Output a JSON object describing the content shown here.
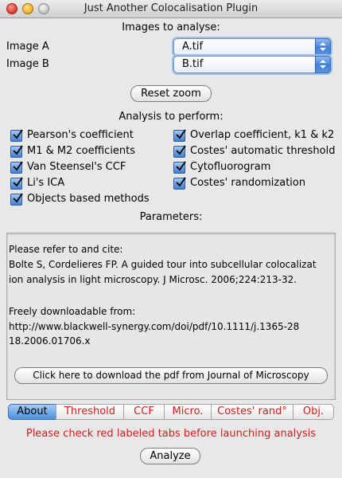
{
  "window": {
    "title": "Just Another Colocalisation Plugin"
  },
  "images": {
    "heading": "Images to analyse:",
    "image_a_label": "Image A",
    "image_a_value": "A.tif",
    "image_b_label": "Image B",
    "image_b_value": "B.tif"
  },
  "reset_zoom_label": "Reset zoom",
  "analysis": {
    "heading": "Analysis to perform:",
    "left": [
      "Pearson's coefficient",
      "M1 & M2 coefficients",
      "Van Steensel's CCF",
      "Li's ICA",
      "Objects based methods"
    ],
    "right": [
      "Overlap coefficient, k1 & k2",
      "Costes' automatic threshold",
      "Cytofluorogram",
      "Costes' randomization"
    ]
  },
  "parameters": {
    "heading": "Parameters:",
    "text_lines": [
      "Please refer to and cite:",
      "Bolte S, Cordelieres FP. A guided tour into subcellular colocalizat",
      "ion  analysis in light microscopy. J Microsc. 2006;224:213-32.",
      "",
      "Freely downloadable from:",
      "http://www.blackwell-synergy.com/doi/pdf/10.1111/j.1365-28",
      "18.2006.01706.x"
    ],
    "download_button": "Click here to download the pdf from Journal of Microscopy"
  },
  "tabs": [
    "About",
    "Threshold",
    "CCF",
    "Micro.",
    "Costes' rand°",
    "Obj."
  ],
  "selected_tab": "About",
  "warning": "Please check red labeled tabs before launching analysis",
  "analyze_button": "Analyze",
  "colors": {
    "accent": "#3f7fd6",
    "warning": "#d51c1c"
  }
}
